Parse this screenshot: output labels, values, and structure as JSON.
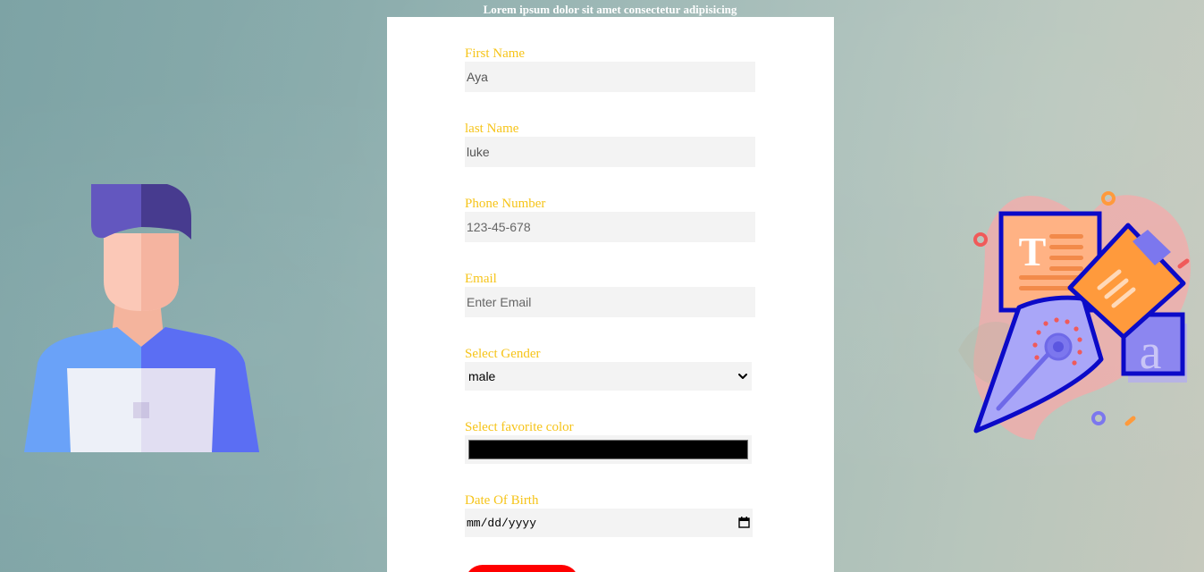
{
  "header": {
    "text": "Lorem ipsum dolor sit amet consectetur adipisicing"
  },
  "form": {
    "first_name": {
      "label": "First Name",
      "value": "Aya"
    },
    "last_name": {
      "label": "last Name",
      "value": "luke"
    },
    "phone": {
      "label": "Phone Number",
      "placeholder": "123-45-678"
    },
    "email": {
      "label": "Email",
      "placeholder": "Enter Email"
    },
    "gender": {
      "label": "Select Gender",
      "selected": "male"
    },
    "color": {
      "label": "Select favorite color",
      "value": "#000000"
    },
    "dob": {
      "label": "Date Of Birth",
      "placeholder": "mm/dd/yyyy"
    },
    "submit_label": ""
  },
  "colors": {
    "label_color": "#f6c419",
    "submit_background": "#ff0000",
    "input_background": "#f3f3f3",
    "card_background": "#ffffff"
  },
  "icons": {
    "left": "person-with-laptop-icon",
    "right": "pen-tool-typography-icon",
    "select": "chevron-down-icon",
    "date": "calendar-icon"
  }
}
